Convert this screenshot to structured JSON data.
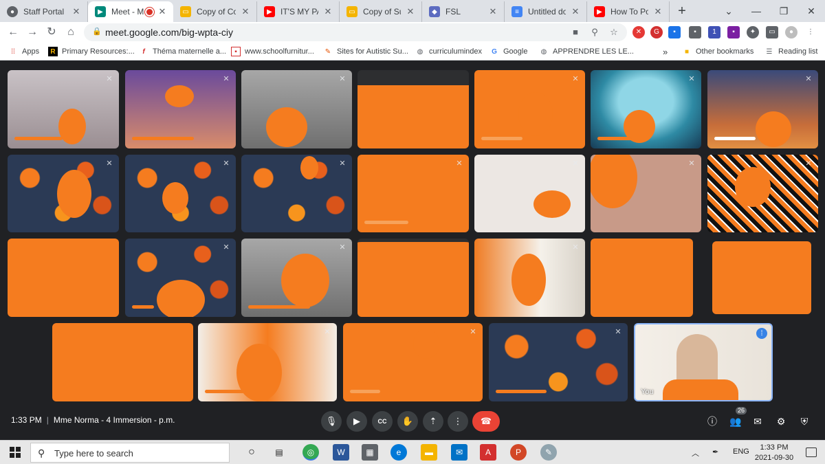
{
  "browser": {
    "tabs": [
      {
        "title": "Staff Portal",
        "icon": "staff-portal-icon",
        "color": "#5f6368"
      },
      {
        "title": "Meet - M",
        "icon": "meet-icon",
        "color": "#00897b",
        "active": true
      },
      {
        "title": "Copy of Copy",
        "icon": "slides-icon",
        "color": "#f4b400"
      },
      {
        "title": "IT'S MY PARTY",
        "icon": "youtube-icon",
        "color": "#ff0000"
      },
      {
        "title": "Copy of Sugg",
        "icon": "slides-icon",
        "color": "#f4b400"
      },
      {
        "title": "FSL",
        "icon": "fsl-icon",
        "color": "#5c6bc0"
      },
      {
        "title": "Untitled docu",
        "icon": "docs-icon",
        "color": "#4285f4"
      },
      {
        "title": "How To Pow",
        "icon": "youtube-icon",
        "color": "#ff0000"
      }
    ],
    "new_tab_symbol": "+",
    "url": "meet.google.com/big-wpta-ciy"
  },
  "bookmarks": [
    {
      "label": "Apps",
      "icon": "apps-grid-icon"
    },
    {
      "label": "Primary Resources:...",
      "icon": "primary-resources-icon"
    },
    {
      "label": "Théma maternelle a...",
      "icon": "thema-icon"
    },
    {
      "label": "www.schoolfurnitur...",
      "icon": "school-furniture-icon"
    },
    {
      "label": "Sites for Autistic Su...",
      "icon": "sites-icon"
    },
    {
      "label": "curriculumindex",
      "icon": "globe-icon"
    },
    {
      "label": "Google",
      "icon": "google-icon"
    },
    {
      "label": "APPRENDRE LES LE...",
      "icon": "globe-icon"
    }
  ],
  "bookmarks_overflow": "»",
  "other_bookmarks": "Other bookmarks",
  "reading_list": "Reading list",
  "meet": {
    "self_label": "You",
    "time": "1:33 PM",
    "meeting_name": "Mme Norma - 4 Immersion - p.m.",
    "participant_count": "26"
  },
  "taskbar": {
    "search_placeholder": "Type here to search",
    "language": "ENG",
    "time": "1:33 PM",
    "date": "2021-09-30"
  },
  "colors": {
    "accent_orange": "#f57c1f",
    "meet_bg": "#202124",
    "end_call": "#ea4335"
  }
}
